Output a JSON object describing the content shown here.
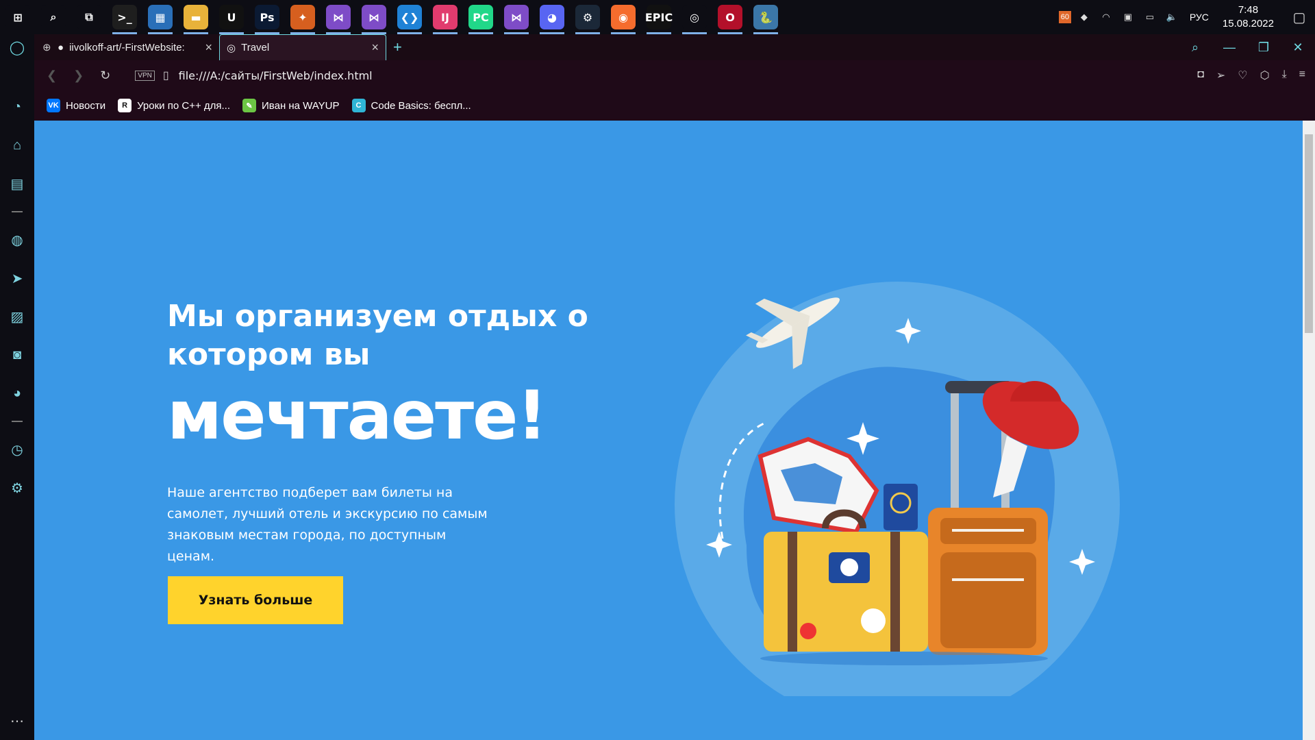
{
  "taskbar": {
    "apps": [
      {
        "name": "start",
        "label": "⊞",
        "color": "#0d0d14"
      },
      {
        "name": "search",
        "label": "⌕",
        "color": "#0d0d14"
      },
      {
        "name": "task-view",
        "label": "⧉",
        "color": "#0d0d14"
      },
      {
        "name": "terminal",
        "label": ">_",
        "color": "#1e1e1e"
      },
      {
        "name": "control-panel",
        "label": "▦",
        "color": "#2a6fb8"
      },
      {
        "name": "file-explorer",
        "label": "▬",
        "color": "#e8b23a"
      },
      {
        "name": "unreal-engine",
        "label": "U",
        "color": "#111"
      },
      {
        "name": "photoshop",
        "label": "Ps",
        "color": "#0b1a33"
      },
      {
        "name": "fl-studio",
        "label": "✦",
        "color": "#d65f1f"
      },
      {
        "name": "visual-studio-installer",
        "label": "⋈",
        "color": "#7e4cc7"
      },
      {
        "name": "visual-studio",
        "label": "⋈",
        "color": "#7e4cc7"
      },
      {
        "name": "vs-code",
        "label": "❮❯",
        "color": "#1f82d6"
      },
      {
        "name": "intellij",
        "label": "IJ",
        "color": "#e13b6e"
      },
      {
        "name": "pycharm",
        "label": "PC",
        "color": "#21d789"
      },
      {
        "name": "visual-studio-2",
        "label": "⋈",
        "color": "#7e4cc7"
      },
      {
        "name": "discord",
        "label": "◕",
        "color": "#5865f2"
      },
      {
        "name": "steam",
        "label": "⚙",
        "color": "#1b2838"
      },
      {
        "name": "origin",
        "label": "◉",
        "color": "#f56c2d"
      },
      {
        "name": "epic-games",
        "label": "EPIC",
        "color": "#111"
      },
      {
        "name": "ubisoft",
        "label": "◎",
        "color": "#0d0d14"
      },
      {
        "name": "opera-gx",
        "label": "O",
        "color": "#b3102a"
      },
      {
        "name": "python",
        "label": "🐍",
        "color": "#3b77a8"
      }
    ],
    "tray": {
      "battery_badge": "60",
      "language": "РУС",
      "time": "7:48",
      "date": "15.08.2022"
    }
  },
  "browser": {
    "tabs": [
      {
        "title": "iivolkoff-art/-FirstWebsite:",
        "icon": "github-icon"
      },
      {
        "title": "Travel",
        "icon": "globe-icon"
      }
    ],
    "vpn_label": "VPN",
    "url": "file:///A:/сайты/FirstWeb/index.html",
    "bookmarks": [
      {
        "label": "Новости",
        "icon": "vk-icon",
        "icon_text": "VK",
        "color": "#0077ff"
      },
      {
        "label": "Уроки по C++ для...",
        "icon": "r-icon",
        "icon_text": "R",
        "color": "#ffffff"
      },
      {
        "label": "Иван на WAYUP",
        "icon": "wayup-icon",
        "icon_text": "✎",
        "color": "#6cc644"
      },
      {
        "label": "Code Basics: беспл...",
        "icon": "codebasics-icon",
        "icon_text": "C",
        "color": "#2fb5d6"
      }
    ]
  },
  "page": {
    "headline": "Мы организуем отдых о котором вы",
    "headline_big": "мечтаете!",
    "description": "Наше агентство подберет вам билеты на самолет, лучший отель и экскурсию по самым знаковым местам города, по доступным ценам.",
    "cta_label": "Узнать больше",
    "colors": {
      "background": "#3a98e6",
      "button": "#ffd32c"
    }
  }
}
